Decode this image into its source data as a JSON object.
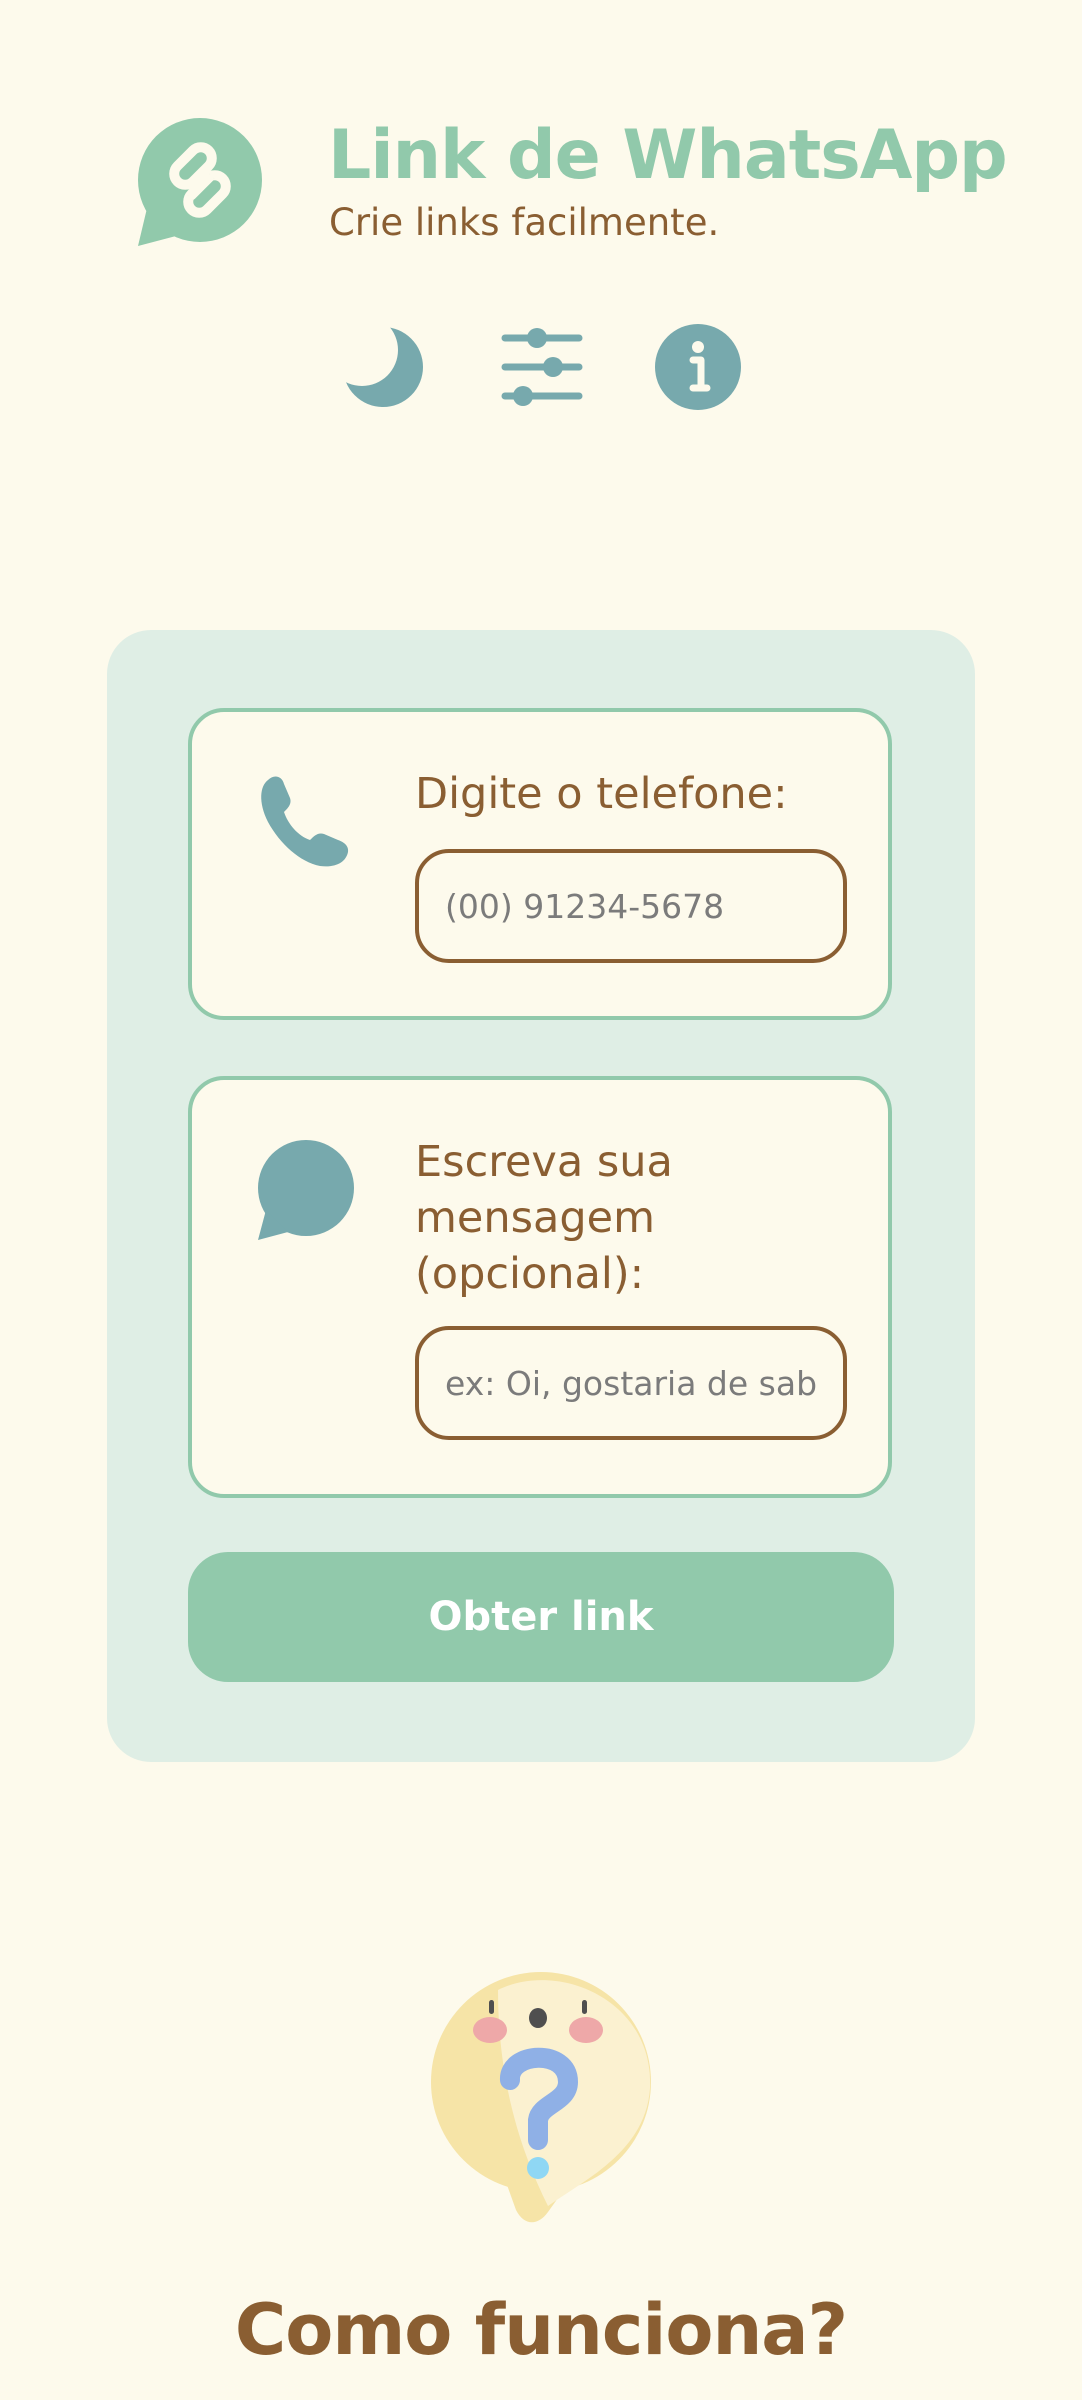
{
  "header": {
    "title": "Link de WhatsApp",
    "subtitle": "Crie links facilmente.",
    "logo_icon": "chat-bubble-link-icon"
  },
  "toolbar": {
    "items": [
      {
        "icon": "moon-icon",
        "label": "theme toggle"
      },
      {
        "icon": "sliders-icon",
        "label": "settings"
      },
      {
        "icon": "info-icon",
        "label": "info"
      }
    ]
  },
  "form": {
    "phone": {
      "label": "Digite o telefone:",
      "placeholder": "(00) 91234-5678",
      "value": "",
      "icon": "phone-icon"
    },
    "message": {
      "label": "Escreva sua mensagem (opcional):",
      "placeholder": "ex: Oi, gostaria de saber mais",
      "value": "",
      "icon": "chat-bubble-icon"
    },
    "submit_label": "Obter link"
  },
  "how_it_works": {
    "heading": "Como funciona?",
    "illustration": "question-bubble-icon"
  },
  "colors": {
    "background": "#FDFAEC",
    "accent_green": "#91C9AB",
    "card_background": "#DFEEE5",
    "icon_teal": "#77A9AD",
    "text_brown": "#8A5E32"
  }
}
